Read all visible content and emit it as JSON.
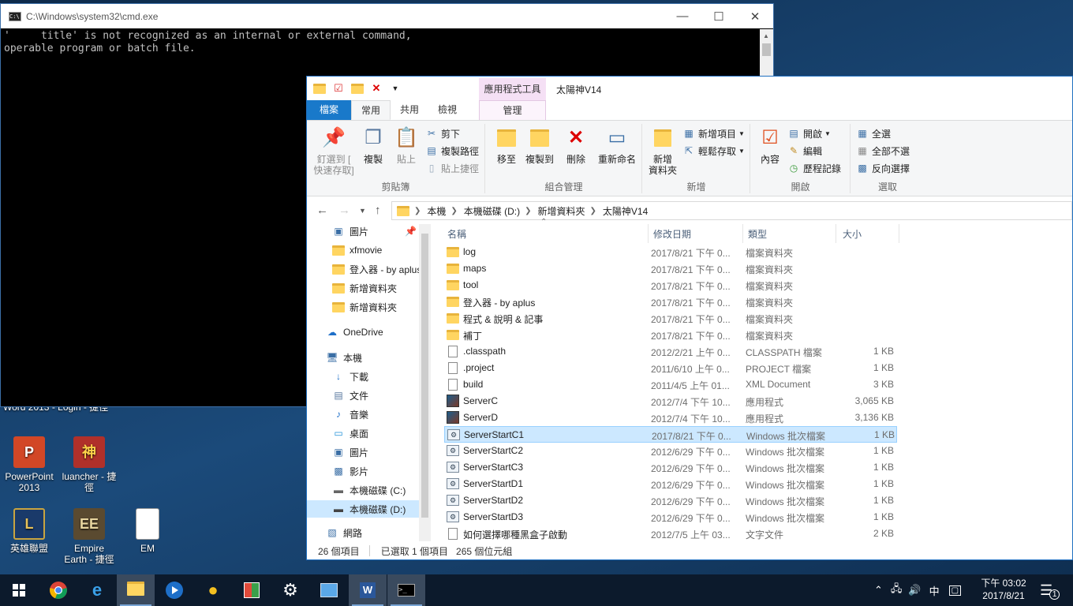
{
  "desktop": {
    "cut_label": "Word 2013 - Login - 捷徑",
    "icons": [
      {
        "label1": "PowerPoint",
        "label2": "2013",
        "icon": "powerpoint-icon"
      },
      {
        "label1": "luancher - 捷",
        "label2": "徑",
        "icon": "launcher-icon"
      },
      {
        "label1": "英雄聯盟",
        "label2": "",
        "icon": "league-of-legends-icon"
      },
      {
        "label1": "Empire",
        "label2": "Earth - 捷徑",
        "icon": "empire-earth-icon"
      },
      {
        "label1": "EM",
        "label2": "",
        "icon": "text-file-icon"
      }
    ]
  },
  "cmd": {
    "title": "C:\\Windows\\system32\\cmd.exe",
    "line1": "'     title' is not recognized as an internal or external command,",
    "line2": "operable program or batch file."
  },
  "explorer": {
    "context_tab_top": "應用程式工具",
    "window_title": "太陽神V14",
    "tabs": {
      "file": "檔案",
      "home": "常用",
      "share": "共用",
      "view": "檢視",
      "manage": "管理"
    },
    "ribbon": {
      "clipboard": {
        "name": "剪貼簿",
        "pin": "釘選到 [",
        "pin2": "快速存取]",
        "copy": "複製",
        "paste": "貼上",
        "cut": "剪下",
        "copy_path": "複製路徑",
        "paste_shortcut": "貼上捷徑"
      },
      "organize": {
        "name": "組合管理",
        "move_to": "移至",
        "copy_to": "複製到",
        "delete": "刪除",
        "rename": "重新命名"
      },
      "new": {
        "name": "新增",
        "new_folder": "新增",
        "new_folder2": "資料夾",
        "new_item": "新增項目",
        "easy_access": "輕鬆存取"
      },
      "open": {
        "name": "開啟",
        "properties": "內容",
        "open": "開啟",
        "edit": "編輯",
        "history": "歷程記錄"
      },
      "select": {
        "name": "選取",
        "select_all": "全選",
        "select_none": "全部不選",
        "invert": "反向選擇"
      }
    },
    "address": {
      "crumbs": [
        "本機",
        "本機磁碟 (D:)",
        "新增資料夾",
        "太陽神V14"
      ]
    },
    "nav": {
      "items": [
        "圖片",
        "xfmovie",
        "登入器 - by aplus",
        "新增資料夾",
        "新增資料夾",
        "OneDrive",
        "本機",
        "下載",
        "文件",
        "音樂",
        "桌面",
        "圖片",
        "影片",
        "本機磁碟 (C:)",
        "本機磁碟 (D:)",
        "網路"
      ]
    },
    "columns": {
      "name": "名稱",
      "date": "修改日期",
      "type": "類型",
      "size": "大小"
    },
    "files": [
      {
        "name": "log",
        "date": "2017/8/21 下午 0...",
        "type": "檔案資料夾",
        "size": "",
        "kind": "folder"
      },
      {
        "name": "maps",
        "date": "2017/8/21 下午 0...",
        "type": "檔案資料夾",
        "size": "",
        "kind": "folder"
      },
      {
        "name": "tool",
        "date": "2017/8/21 下午 0...",
        "type": "檔案資料夾",
        "size": "",
        "kind": "folder"
      },
      {
        "name": "登入器 - by aplus",
        "date": "2017/8/21 下午 0...",
        "type": "檔案資料夾",
        "size": "",
        "kind": "folder"
      },
      {
        "name": "程式 & 說明 & 記事",
        "date": "2017/8/21 下午 0...",
        "type": "檔案資料夾",
        "size": "",
        "kind": "folder"
      },
      {
        "name": "補丁",
        "date": "2017/8/21 下午 0...",
        "type": "檔案資料夾",
        "size": "",
        "kind": "folder"
      },
      {
        "name": ".classpath",
        "date": "2012/2/21 上午 0...",
        "type": "CLASSPATH 檔案",
        "size": "1 KB",
        "kind": "doc"
      },
      {
        "name": ".project",
        "date": "2011/6/10 上午 0...",
        "type": "PROJECT 檔案",
        "size": "1 KB",
        "kind": "doc"
      },
      {
        "name": "build",
        "date": "2011/4/5 上午 01...",
        "type": "XML Document",
        "size": "3 KB",
        "kind": "doc"
      },
      {
        "name": "ServerC",
        "date": "2012/7/4 下午 10...",
        "type": "應用程式",
        "size": "3,065 KB",
        "kind": "exe"
      },
      {
        "name": "ServerD",
        "date": "2012/7/4 下午 10...",
        "type": "應用程式",
        "size": "3,136 KB",
        "kind": "exe"
      },
      {
        "name": "ServerStartC1",
        "date": "2017/8/21 下午 0...",
        "type": "Windows 批次檔案",
        "size": "1 KB",
        "kind": "bat"
      },
      {
        "name": "ServerStartC2",
        "date": "2012/6/29 下午 0...",
        "type": "Windows 批次檔案",
        "size": "1 KB",
        "kind": "bat"
      },
      {
        "name": "ServerStartC3",
        "date": "2012/6/29 下午 0...",
        "type": "Windows 批次檔案",
        "size": "1 KB",
        "kind": "bat"
      },
      {
        "name": "ServerStartD1",
        "date": "2012/6/29 下午 0...",
        "type": "Windows 批次檔案",
        "size": "1 KB",
        "kind": "bat"
      },
      {
        "name": "ServerStartD2",
        "date": "2012/6/29 下午 0...",
        "type": "Windows 批次檔案",
        "size": "1 KB",
        "kind": "bat"
      },
      {
        "name": "ServerStartD3",
        "date": "2012/6/29 下午 0...",
        "type": "Windows 批次檔案",
        "size": "1 KB",
        "kind": "bat"
      },
      {
        "name": "如何選擇哪種黑盒子啟動",
        "date": "2012/7/5 上午 03...",
        "type": "文字文件",
        "size": "2 KB",
        "kind": "doc"
      }
    ],
    "selected_file": "ServerStartC1",
    "status": {
      "count": "26 個項目",
      "selected": "已選取 1 個項目",
      "size": "265 個位元組"
    }
  },
  "taskbar": {
    "ime": "中",
    "time": "下午 03:02",
    "date": "2017/8/21",
    "notif_count": "1"
  }
}
